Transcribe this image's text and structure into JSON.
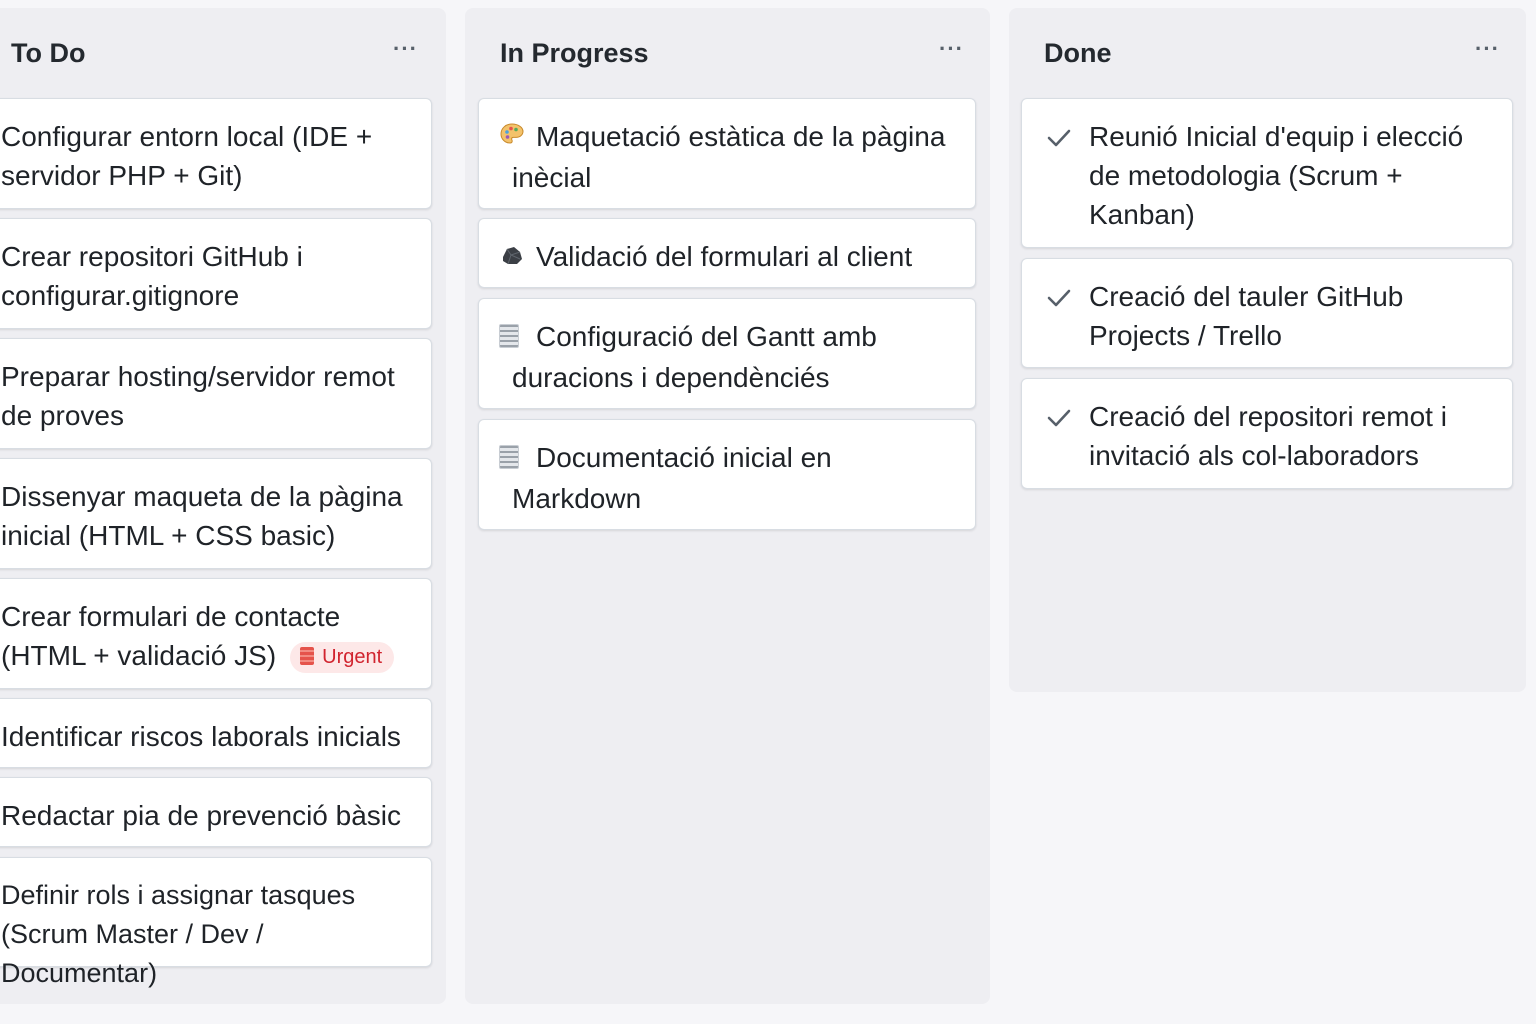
{
  "columns": {
    "todo": {
      "title": "To Do",
      "menu": "···",
      "cards": [
        {
          "text": "Configurar entorn local (IDE + servidor PHP + Git)"
        },
        {
          "text": "Crear repositori GitHub i configurar.gitignore"
        },
        {
          "text": "Preparar hosting/servidor remot de proves"
        },
        {
          "text": "Dissenyar maqueta de la pàgina inicial (HTML + CSS basic)"
        },
        {
          "text": "Crear formulari de contacte (HTML + validació JS)",
          "badge": "Urgent"
        },
        {
          "text": "Identificar riscos laborals inicials"
        },
        {
          "text": "Redactar pia de prevenció bàsic"
        },
        {
          "text": "Definir rols i assignar tasques (Scrum Master / Dev / Documentar)"
        }
      ]
    },
    "in_progress": {
      "title": "In Progress",
      "menu": "···",
      "cards": [
        {
          "text": "Maquetació estàtica de la pàgina inècial",
          "icon": "palette-icon"
        },
        {
          "text": "Validació del formulari al client",
          "icon": "rock-icon"
        },
        {
          "text": "Configuració del Gantt amb duracions i dependènciés",
          "icon": "document-icon"
        },
        {
          "text": "Documentació inicial en Markdown",
          "icon": "document-icon"
        }
      ]
    },
    "done": {
      "title": "Done",
      "menu": "···",
      "cards": [
        {
          "text": "Reunió Inicial d'equip i elecció de metodologia (Scrum + Kanban)",
          "icon": "check-icon"
        },
        {
          "text": "Creació del tauler GitHub Projects / Trello",
          "icon": "check-icon"
        },
        {
          "text": "Creació del repositori remot i invitació als col-laboradors",
          "icon": "check-icon"
        }
      ]
    }
  },
  "colors": {
    "background": "#f6f6f9",
    "column": "#eeeef2",
    "card": "#ffffff",
    "urgent_bg": "#fde8e8",
    "urgent_text": "#d1242f",
    "check": "#57606a"
  }
}
